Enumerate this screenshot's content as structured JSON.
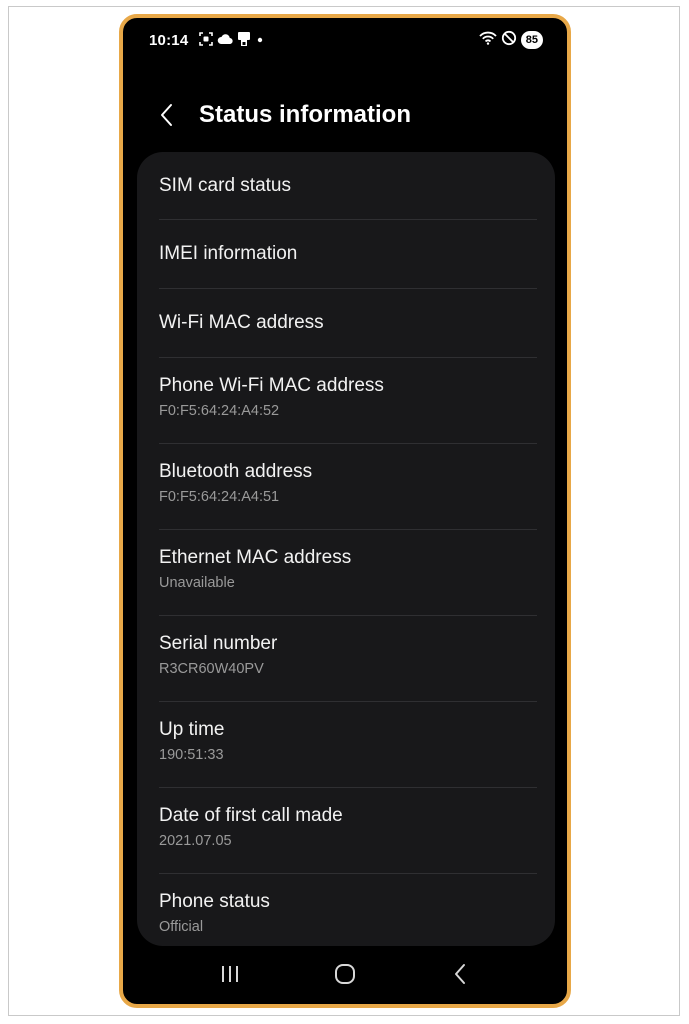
{
  "status_bar": {
    "time": "10:14",
    "battery": "85",
    "icons_left": [
      "screenshot-icon",
      "cloud-icon",
      "nfc-icon",
      "dot-icon"
    ],
    "icons_right": [
      "wifi-icon",
      "do-not-disturb-icon",
      "battery-icon"
    ]
  },
  "header": {
    "back_icon": "back-chevron-icon",
    "title": "Status information"
  },
  "items": [
    {
      "label": "SIM card status",
      "value": ""
    },
    {
      "label": "IMEI information",
      "value": ""
    },
    {
      "label": "Wi-Fi MAC address",
      "value": ""
    },
    {
      "label": "Phone Wi-Fi MAC address",
      "value": "F0:F5:64:24:A4:52"
    },
    {
      "label": "Bluetooth address",
      "value": "F0:F5:64:24:A4:51"
    },
    {
      "label": "Ethernet MAC address",
      "value": "Unavailable"
    },
    {
      "label": "Serial number",
      "value": "R3CR60W40PV"
    },
    {
      "label": "Up time",
      "value": "190:51:33"
    },
    {
      "label": "Date of first call made",
      "value": "2021.07.05"
    },
    {
      "label": "Phone status",
      "value": "Official"
    }
  ],
  "navbar": {
    "buttons": [
      "recents-icon",
      "home-icon",
      "back-icon"
    ]
  },
  "colors": {
    "accent_border": "#e8a848",
    "background": "#000000",
    "card": "#18181a"
  }
}
